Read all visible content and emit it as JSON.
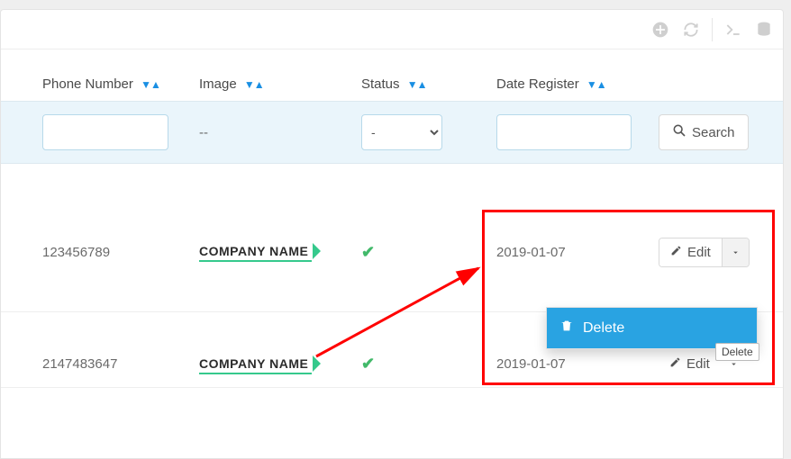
{
  "columns": {
    "phone": "Phone Number",
    "image": "Image",
    "status": "Status",
    "date": "Date Register"
  },
  "filter": {
    "image_placeholder": "--",
    "status_default": "-",
    "search_label": "Search"
  },
  "rows": [
    {
      "phone": "123456789",
      "image_label": "COMPANY NAME",
      "date": "2019-01-07",
      "edit_label": "Edit"
    },
    {
      "phone": "2147483647",
      "image_label": "COMPANY NAME",
      "date": "2019-01-07",
      "edit_label": "Edit"
    }
  ],
  "dropdown": {
    "delete_label": "Delete",
    "tooltip": "Delete"
  }
}
